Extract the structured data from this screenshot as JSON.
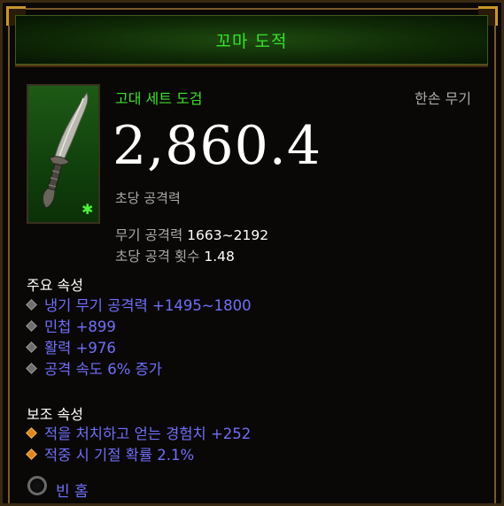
{
  "header": {
    "item_name": "꼬마 도적"
  },
  "item": {
    "type_label": "고대 세트 도검",
    "slot_label": "한손 무기",
    "dps_value": "2,860.4",
    "dps_label": "초당 공격력",
    "weapon_damage_label": "무기 공격력",
    "weapon_damage_value": "1663~2192",
    "attack_speed_label": "초당 공격 횟수",
    "attack_speed_value": "1.48"
  },
  "primary": {
    "title": "주요 속성",
    "affixes": [
      "냉기 무기 공격력 +1495~1800",
      "민첩 +899",
      "활력 +976",
      "공격 속도 6% 증가"
    ]
  },
  "secondary": {
    "title": "보조 속성",
    "affixes": [
      "적을 처치하고 얻는 경험치 +252",
      "적중 시 기절 확률 2.1%"
    ]
  },
  "socket": {
    "label": "빈 홈"
  },
  "icons": {
    "item_icon": "dagger-icon",
    "ancient_marker": "green-star-icon",
    "affix_bullet": "diamond-bullet-icon",
    "socket": "empty-socket-icon"
  },
  "colors": {
    "set_green": "#35e22a",
    "affix_blue": "#6f6ff8",
    "secondary_bullet": "#e0861e",
    "gold_frame": "#c8962a"
  }
}
